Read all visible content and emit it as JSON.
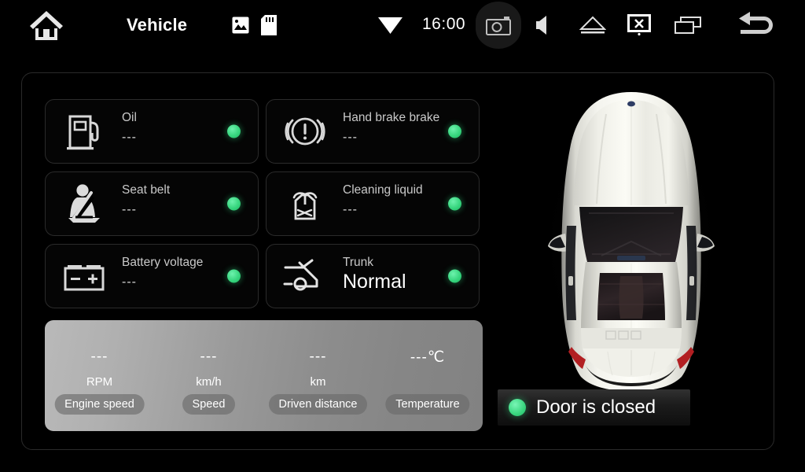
{
  "statusbar": {
    "title": "Vehicle",
    "clock": "16:00",
    "icons": {
      "home": "home-icon",
      "gallery": "image-icon",
      "sdcard": "sd-card-icon",
      "wifi": "wifi-icon",
      "camera": "screenshot-camera-icon",
      "speaker": "volume-icon",
      "eject": "eject-icon",
      "screenoff": "screen-off-icon",
      "recents": "recent-apps-icon",
      "back": "back-arrow-icon"
    }
  },
  "cards": [
    {
      "label": "Oil",
      "value": "---",
      "icon": "fuel-pump-icon",
      "status": "ok",
      "big": false
    },
    {
      "label": "Hand brake brake",
      "value": "---",
      "icon": "hand-brake-icon",
      "status": "ok",
      "big": false
    },
    {
      "label": "Seat belt",
      "value": "---",
      "icon": "seat-belt-icon",
      "status": "ok",
      "big": false
    },
    {
      "label": "Cleaning liquid",
      "value": "---",
      "icon": "washer-fluid-icon",
      "status": "ok",
      "big": false
    },
    {
      "label": "Battery voltage",
      "value": "---",
      "icon": "battery-icon",
      "status": "ok",
      "big": false
    },
    {
      "label": "Trunk",
      "value": "Normal",
      "icon": "trunk-open-icon",
      "status": "ok",
      "big": true
    }
  ],
  "metrics": [
    {
      "value": "---",
      "unit": "RPM",
      "label": "Engine speed"
    },
    {
      "value": "---",
      "unit": "km/h",
      "label": "Speed"
    },
    {
      "value": "---",
      "unit": "km",
      "label": "Driven distance"
    },
    {
      "value": "---℃",
      "unit": "",
      "label": "Temperature"
    }
  ],
  "door": {
    "text": "Door is closed",
    "status": "ok"
  },
  "colors": {
    "background": "#000000",
    "status_ok": "#3ad77f",
    "card_border": "#2b2b2b",
    "panel_border": "#2a2a2a",
    "text_primary": "#ffffff",
    "text_secondary": "#c9c9c9"
  }
}
